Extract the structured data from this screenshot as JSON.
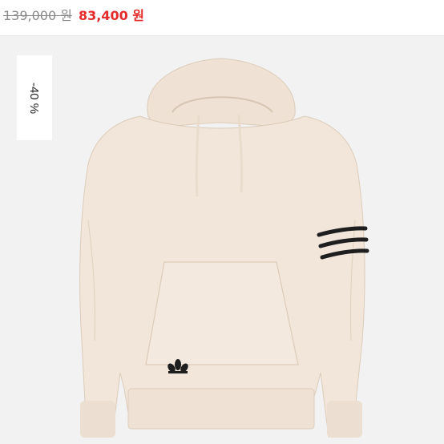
{
  "price": {
    "original": "139,000 원",
    "sale": "83,400 원"
  },
  "badge": {
    "discount": "-40 %"
  },
  "product": {
    "image_icon": "hoodie-image",
    "colors": {
      "hoodie": "#f2e6da",
      "stripes": "#1e1e1e",
      "background": "#f2f2f2",
      "sale_price": "#e32b2b",
      "original_price": "#8a8a8a"
    }
  }
}
